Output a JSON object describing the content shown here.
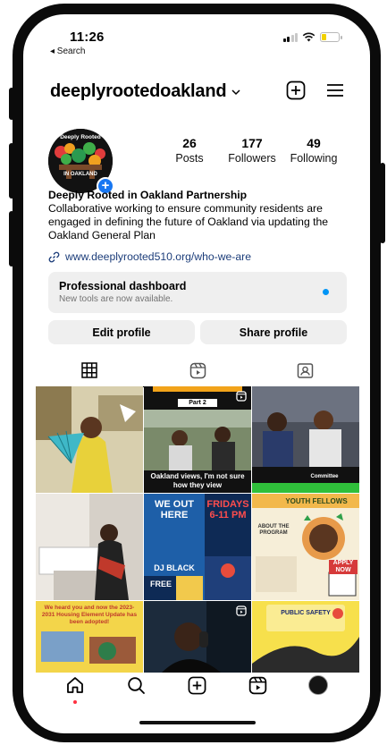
{
  "status_bar": {
    "time": "11:26",
    "back_label": "◂ Search"
  },
  "header": {
    "username": "deeplyrootedoakland"
  },
  "profile": {
    "avatar_logo_line1": "Deeply Rooted",
    "avatar_logo_line2": "IN OAKLAND",
    "stats": [
      {
        "value": "26",
        "label": "Posts"
      },
      {
        "value": "177",
        "label": "Followers"
      },
      {
        "value": "49",
        "label": "Following"
      }
    ],
    "name": "Deeply Rooted in Oakland Partnership",
    "bio": "Collaborative working to ensure community residents are engaged in defining the future of Oakland via updating the Oakland General Plan",
    "link": "www.deeplyrooted510.org/who-we-are"
  },
  "dashboard": {
    "title": "Professional dashboard",
    "subtitle": "New tools are now available."
  },
  "actions": {
    "edit": "Edit profile",
    "share": "Share profile"
  },
  "tabs": [
    "grid-icon",
    "reels-icon",
    "tagged-icon"
  ],
  "posts": [
    {
      "caption": ""
    },
    {
      "caption": "Part 2",
      "caption2": "Oakland views, I'm not sure how they view"
    },
    {
      "caption": "Committee"
    },
    {
      "caption": ""
    },
    {
      "caption": "WE OUT HERE",
      "caption2": "FRIDAYS 6-11 PM",
      "caption3": "DJ BLACK",
      "caption4": "FREE"
    },
    {
      "caption": "YOUTH FELLOWS",
      "caption2": "ABOUT THE PROGRAM",
      "caption3": "APPLY NOW"
    },
    {
      "caption": "We heard you and now the 2023-2031 Housing Element Update has been adopted!"
    },
    {
      "caption": ""
    },
    {
      "caption": "PUBLIC SAFETY"
    }
  ],
  "nav": [
    "home-icon",
    "search-icon",
    "create-icon",
    "reels-icon",
    "profile-avatar"
  ],
  "colors": {
    "accent_blue": "#0095f6",
    "link_blue": "#1c3d7a",
    "badge_blue": "#1877f2",
    "notif_red": "#ff3040"
  }
}
